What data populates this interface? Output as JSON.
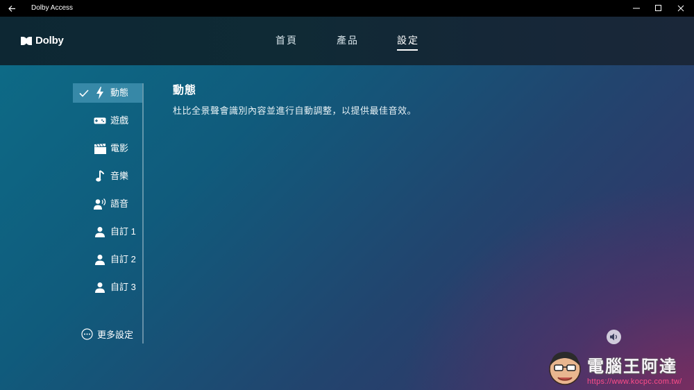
{
  "window": {
    "title": "Dolby Access"
  },
  "header": {
    "logo_text": "Dolby",
    "tabs": [
      {
        "label": "首頁",
        "active": false
      },
      {
        "label": "產品",
        "active": false
      },
      {
        "label": "設定",
        "active": true
      }
    ]
  },
  "sidebar": {
    "items": [
      {
        "label": "動態",
        "icon": "lightning-icon",
        "selected": true
      },
      {
        "label": "遊戲",
        "icon": "gamepad-icon",
        "selected": false
      },
      {
        "label": "電影",
        "icon": "clapperboard-icon",
        "selected": false
      },
      {
        "label": "音樂",
        "icon": "music-note-icon",
        "selected": false
      },
      {
        "label": "語音",
        "icon": "speaking-person-icon",
        "selected": false
      },
      {
        "label": "自訂 1",
        "icon": "person-icon",
        "selected": false
      },
      {
        "label": "自訂 2",
        "icon": "person-icon",
        "selected": false
      },
      {
        "label": "自訂 3",
        "icon": "person-icon",
        "selected": false
      }
    ],
    "more_label": "更多設定"
  },
  "main": {
    "title": "動態",
    "description": "杜比全景聲會識別內容並進行自動調整，以提供最佳音效。"
  },
  "watermark": {
    "text": "電腦王阿達",
    "url": "https://www.kocpc.com.tw/"
  },
  "colors": {
    "titlebar": "#000000",
    "header": "#0f2a35",
    "selected_item": "#4696b4",
    "accent_pink": "#ff4d8a"
  }
}
